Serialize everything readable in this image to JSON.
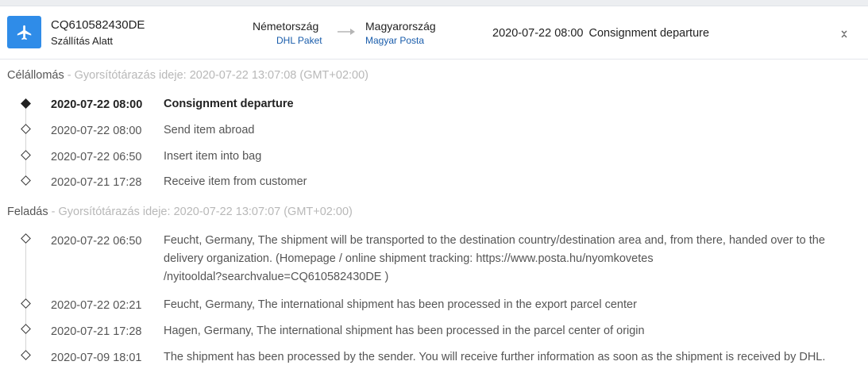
{
  "shipment": {
    "tracking_number": "CQ610582430DE",
    "status": "Szállítás Alatt",
    "icon": "airplane-icon",
    "from": {
      "country": "Németország",
      "carrier": "DHL Paket"
    },
    "to": {
      "country": "Magyarország",
      "carrier": "Magyar Posta"
    },
    "latest": {
      "time": "2020-07-22 08:00",
      "description": "Consignment departure"
    }
  },
  "sections": [
    {
      "name": "Célállomás",
      "separator": " - ",
      "cache_label": "Gyorsítótárazás ideje:",
      "cache_time": "2020-07-22 13:07:08 (GMT+02:00)",
      "events": [
        {
          "time": "2020-07-22 08:00",
          "description": "Consignment departure"
        },
        {
          "time": "2020-07-22 08:00",
          "description": "Send item abroad"
        },
        {
          "time": "2020-07-22 06:50",
          "description": "Insert item into bag"
        },
        {
          "time": "2020-07-21 17:28",
          "description": "Receive item from customer"
        }
      ]
    },
    {
      "name": "Feladás",
      "separator": " - ",
      "cache_label": "Gyorsítótárazás ideje:",
      "cache_time": "2020-07-22 13:07:07 (GMT+02:00)",
      "events": [
        {
          "time": "2020-07-22 06:50",
          "description_lines": [
            "Feucht, Germany, The shipment will be transported to the destination country/destination area and, from there, handed over to the",
            "delivery organization. (Homepage / online shipment tracking: https://www.posta.hu/nyomkovetes",
            "/nyitooldal?searchvalue=CQ610582430DE )"
          ]
        },
        {
          "time": "2020-07-22 02:21",
          "description": "Feucht, Germany, The international shipment has been processed in the export parcel center"
        },
        {
          "time": "2020-07-21 17:28",
          "description": "Hagen, Germany, The international shipment has been processed in the parcel center of origin"
        },
        {
          "time": "2020-07-09 18:01",
          "description": "The shipment has been processed by the sender. You will receive further information as soon as the shipment is received by DHL."
        }
      ]
    }
  ]
}
